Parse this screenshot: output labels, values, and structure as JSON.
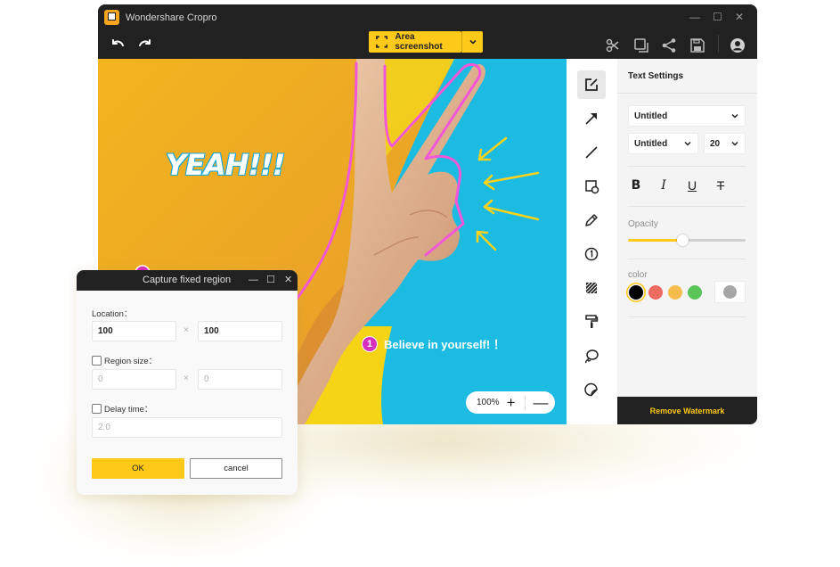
{
  "app": {
    "title": "Wondershare Cropro",
    "window_controls": {
      "minimize": "—",
      "maximize": "☐",
      "close": "✕"
    }
  },
  "toolbar": {
    "undo_icon": "undo-icon",
    "redo_icon": "redo-icon",
    "capture_mode": "Area screenshot",
    "right_icons": [
      "scissors-icon",
      "copy-icon",
      "share-icon",
      "save-icon",
      "account-icon"
    ]
  },
  "canvas": {
    "annotation_text": "YEAH!!!",
    "step_marker": {
      "number": "1",
      "text": "Believe in yourself! ！"
    },
    "zoom": {
      "level": "100%",
      "plus": "+",
      "minus": "—"
    }
  },
  "tools": [
    {
      "name": "text-edit-icon",
      "active": true
    },
    {
      "name": "arrow-icon",
      "active": false
    },
    {
      "name": "line-icon",
      "active": false
    },
    {
      "name": "shape-icon",
      "active": false
    },
    {
      "name": "pencil-icon",
      "active": false
    },
    {
      "name": "step-number-icon",
      "active": false
    },
    {
      "name": "mosaic-icon",
      "active": false
    },
    {
      "name": "paint-roller-icon",
      "active": false
    },
    {
      "name": "lasso-icon",
      "active": false
    },
    {
      "name": "sticker-icon",
      "active": false
    }
  ],
  "settings": {
    "title": "Text Settings",
    "font_family": "Untitled",
    "font_style": "Untitled",
    "font_size": "20",
    "format_buttons": {
      "bold": "B",
      "italic": "I",
      "underline": "U",
      "strikethrough": "T"
    },
    "opacity_label": "Opacity",
    "opacity_value": 0.46,
    "color_label": "color",
    "colors": [
      {
        "hex": "#000000",
        "selected": true
      },
      {
        "hex": "#ee6b60",
        "selected": false
      },
      {
        "hex": "#f5bb4c",
        "selected": false
      },
      {
        "hex": "#5cc55a",
        "selected": false
      }
    ],
    "custom_color": "#a6a6a6",
    "remove_watermark": "Remove Watermark"
  },
  "dialog": {
    "title": "Capture fixed region",
    "location_label": "Location：",
    "location_x": "100",
    "location_y": "100",
    "region_size_label": "Region size：",
    "region_size_checked": false,
    "region_w_placeholder": "0",
    "region_h_placeholder": "0",
    "delay_label": "Delay time：",
    "delay_checked": false,
    "delay_placeholder": "2.0",
    "times_sign": "×",
    "ok": "OK",
    "cancel": "cancel"
  },
  "colors": {
    "accent": "#ffc91a",
    "dark": "#212121",
    "annotation_pink": "#f257d8",
    "annotation_yellow": "#ffd21a"
  }
}
